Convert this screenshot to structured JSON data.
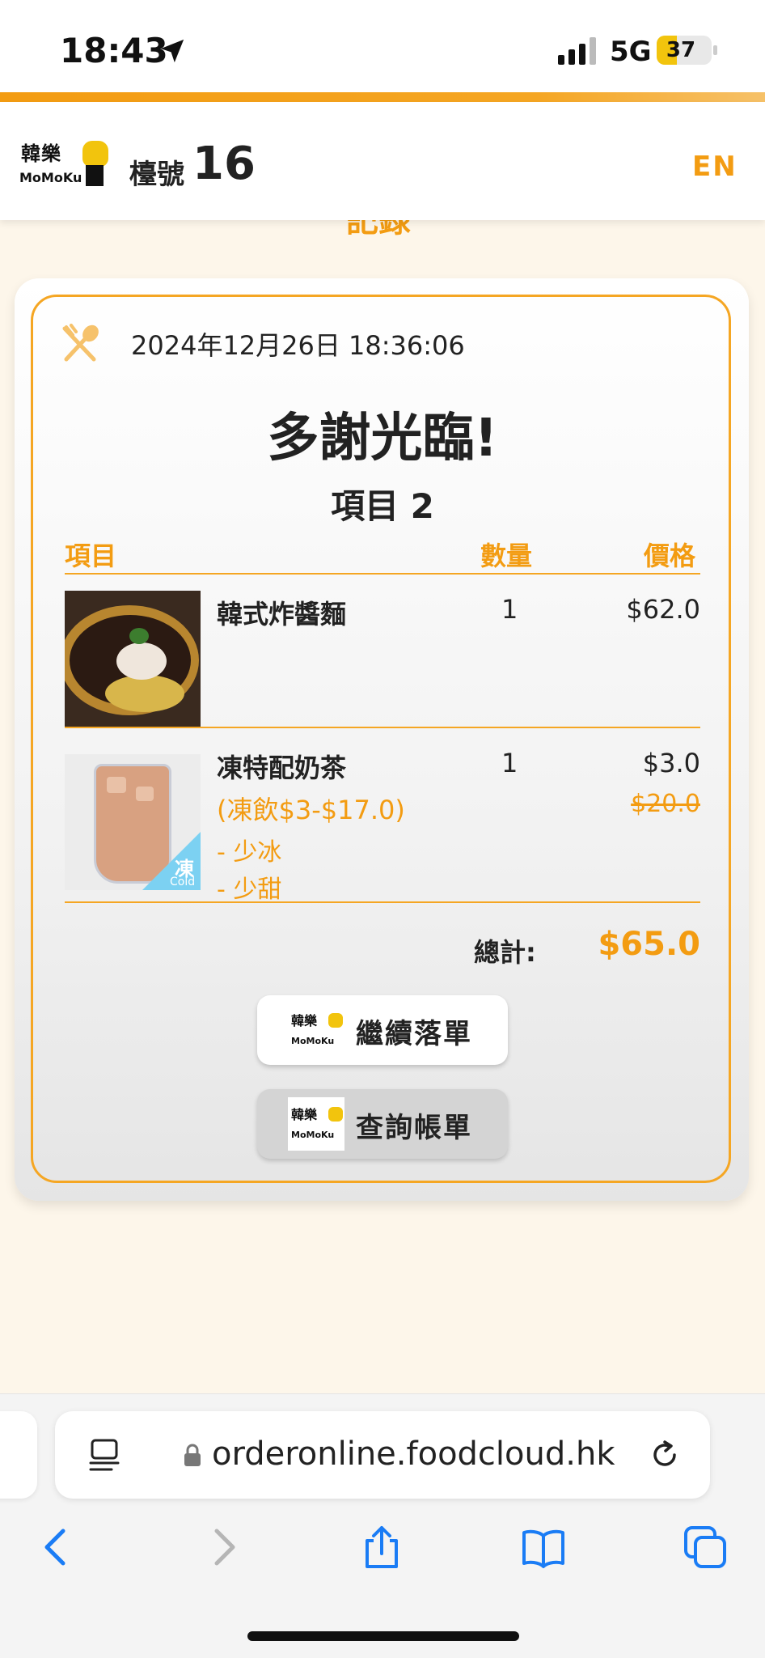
{
  "status_bar": {
    "time": "18:43",
    "network": "5G",
    "battery": "37",
    "battery_level": 0.37
  },
  "header": {
    "logo_line1": "韓樂",
    "logo_line2": "MoMoKu",
    "table_label": "檯號",
    "table_number": "16",
    "lang_toggle": "EN"
  },
  "page": {
    "hidden_title": "記錄"
  },
  "order": {
    "datetime": "2024年12月26日 18:36:06",
    "thanks": "多謝光臨!",
    "items_count": "項目 2",
    "columns": {
      "item": "項目",
      "qty": "數量",
      "price": "價格"
    },
    "items": [
      {
        "name": "韓式炸醬麵",
        "qty": "1",
        "price": "$62.0"
      },
      {
        "name": "凍特配奶茶",
        "qty": "1",
        "price": "$3.0",
        "original_price": "$20.0",
        "variant": "(凍飲$3-$17.0)",
        "options": [
          "- 少冰",
          "- 少甜"
        ],
        "badge_zh": "凍",
        "badge_en": "Cold"
      }
    ],
    "total_label": "總計:",
    "total_value": "$65.0"
  },
  "buttons": {
    "continue_order": "繼續落單",
    "view_bill": "查詢帳單"
  },
  "browser": {
    "url": "orderonline.foodcloud.hk"
  },
  "colors": {
    "accent": "#f39c12",
    "background": "#fdf6ea",
    "ios_blue": "#1a7cf5"
  }
}
